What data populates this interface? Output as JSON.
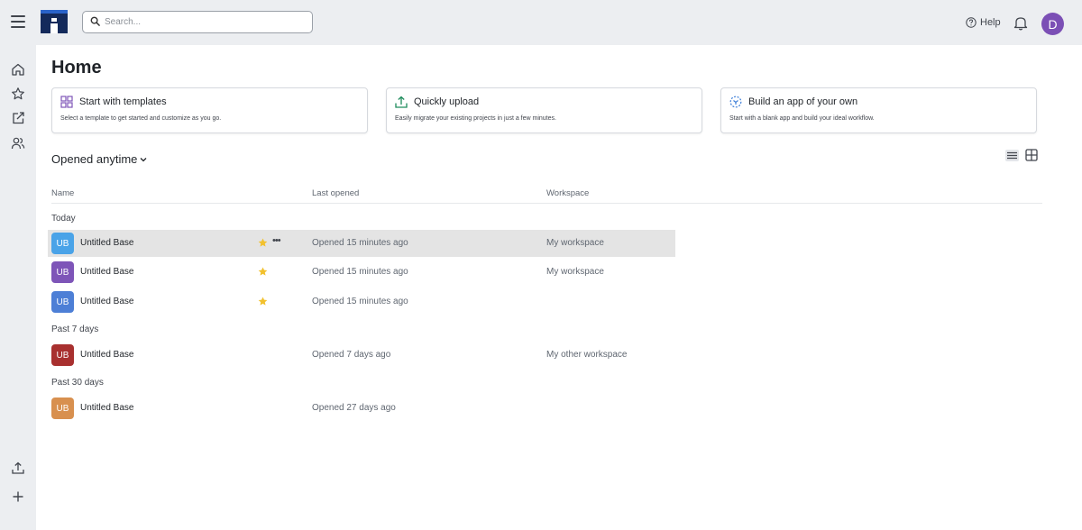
{
  "header": {
    "search_placeholder": "Search...",
    "help_label": "Help",
    "avatar_initial": "D"
  },
  "sidebar": {
    "top_icons": [
      "home-icon",
      "star-icon",
      "share-icon",
      "users-icon"
    ],
    "bottom_icons": [
      "upload-icon",
      "plus-icon"
    ]
  },
  "main": {
    "title": "Home",
    "cards": [
      {
        "title": "Start with templates",
        "description": "Select a template to get started and customize as you go.",
        "icon": "templates-grid-icon"
      },
      {
        "title": "Quickly upload",
        "description": "Easily migrate your existing projects in just a few minutes.",
        "icon": "upload-icon"
      },
      {
        "title": "Build an app of your own",
        "description": "Start with a blank app and build your ideal workflow.",
        "icon": "build-app-icon"
      }
    ],
    "filter_label": "Opened anytime",
    "columns": {
      "name": "Name",
      "last_opened": "Last opened",
      "workspace": "Workspace"
    },
    "groups": [
      {
        "label": "Today",
        "rows": [
          {
            "initials": "UB",
            "name": "Untitled Base",
            "opened": "Opened 15 minutes ago",
            "workspace": "My workspace",
            "starred": true,
            "color": "#4aa3e8"
          },
          {
            "initials": "UB",
            "name": "Untitled Base",
            "opened": "Opened 15 minutes ago",
            "workspace": "My workspace",
            "starred": true,
            "color": "#7e55b8"
          },
          {
            "initials": "UB",
            "name": "Untitled Base",
            "opened": "Opened 15 minutes ago",
            "workspace": "",
            "starred": true,
            "color": "#4d7fd6"
          }
        ]
      },
      {
        "label": "Past 7 days",
        "rows": [
          {
            "initials": "UB",
            "name": "Untitled Base",
            "opened": "Opened 7 days ago",
            "workspace": "My other workspace",
            "starred": false,
            "color": "#a8302f"
          }
        ]
      },
      {
        "label": "Past 30 days",
        "rows": [
          {
            "initials": "UB",
            "name": "Untitled Base",
            "opened": "Opened 27 days ago",
            "workspace": "",
            "starred": false,
            "color": "#d8904f"
          }
        ]
      }
    ],
    "star_color": "#f2c12e"
  }
}
